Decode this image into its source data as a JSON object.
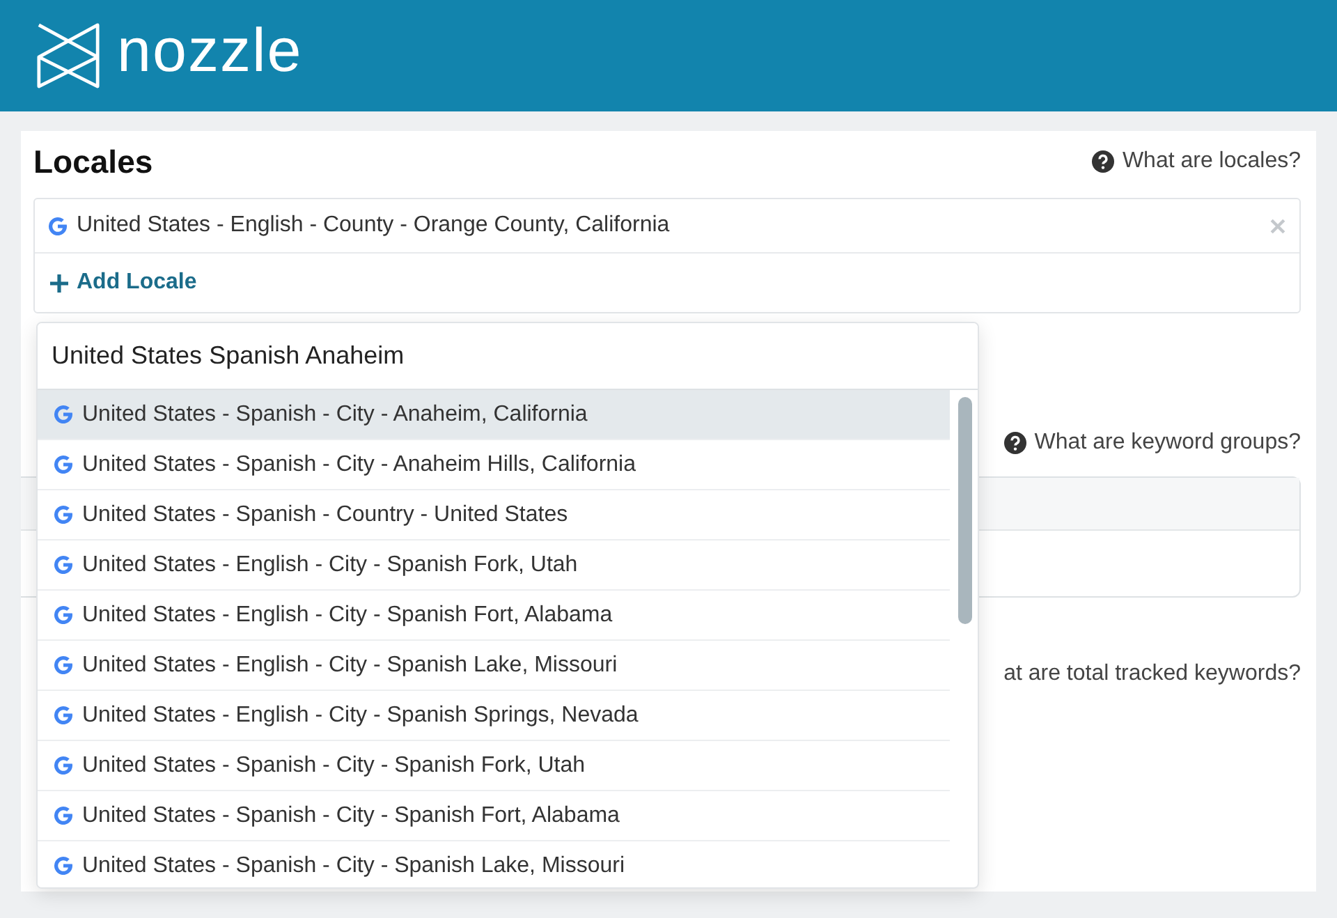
{
  "header": {
    "logo_text": "nozzle"
  },
  "locales": {
    "title": "Locales",
    "help": "What are locales?",
    "selected": [
      {
        "label": "United States - English - County - Orange County, California"
      }
    ],
    "add_label": "Add Locale"
  },
  "keyword_groups": {
    "help": "What are keyword groups?"
  },
  "tracked_keywords": {
    "help": "at are total tracked keywords?"
  },
  "locale_search": {
    "value": "United States Spanish Anaheim",
    "results": [
      {
        "label": "United States - Spanish - City - Anaheim, California",
        "selected": true
      },
      {
        "label": "United States - Spanish - City - Anaheim Hills, California",
        "selected": false
      },
      {
        "label": "United States - Spanish - Country - United States",
        "selected": false
      },
      {
        "label": "United States - English - City - Spanish Fork, Utah",
        "selected": false
      },
      {
        "label": "United States - English - City - Spanish Fort, Alabama",
        "selected": false
      },
      {
        "label": "United States - English - City - Spanish Lake, Missouri",
        "selected": false
      },
      {
        "label": "United States - English - City - Spanish Springs, Nevada",
        "selected": false
      },
      {
        "label": "United States - Spanish - City - Spanish Fork, Utah",
        "selected": false
      },
      {
        "label": "United States - Spanish - City - Spanish Fort, Alabama",
        "selected": false
      },
      {
        "label": "United States - Spanish - City - Spanish Lake, Missouri",
        "selected": false
      }
    ]
  }
}
